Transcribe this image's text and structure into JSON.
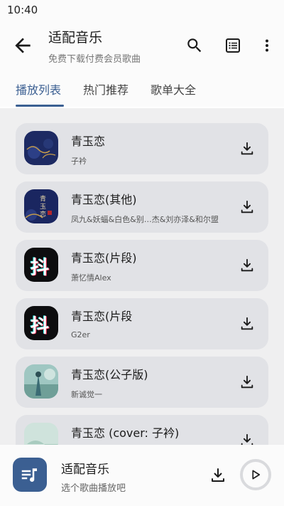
{
  "status_bar": {
    "time": "10:40"
  },
  "app_bar": {
    "title": "适配音乐",
    "subtitle": "免费下载付费会员歌曲",
    "icons": [
      "back-arrow-icon",
      "search-icon",
      "list-icon",
      "more-vert-icon"
    ]
  },
  "tabs": [
    {
      "label": "播放列表",
      "active": true
    },
    {
      "label": "热门推荐",
      "active": false
    },
    {
      "label": "歌单大全",
      "active": false
    }
  ],
  "songs": [
    {
      "title": "青玉恋",
      "artist": "子衿"
    },
    {
      "title": "青玉恋(其他)",
      "artist": "凤九&妖蝠&白色&别…杰&刘亦泽&和尔盟"
    },
    {
      "title": "青玉恋(片段)",
      "artist": "萧忆情Alex"
    },
    {
      "title": "青玉恋(片段",
      "artist": "G2er"
    },
    {
      "title": "青玉恋(公子版)",
      "artist": "新诚觉一"
    },
    {
      "title": "青玉恋 (cover: 子衿)",
      "artist": ""
    }
  ],
  "player": {
    "title": "适配音乐",
    "subtitle": "选个歌曲播放吧"
  },
  "colors": {
    "accent": "#3b5f92",
    "card_bg": "#e1e2e6",
    "list_bg": "#efeff0"
  }
}
